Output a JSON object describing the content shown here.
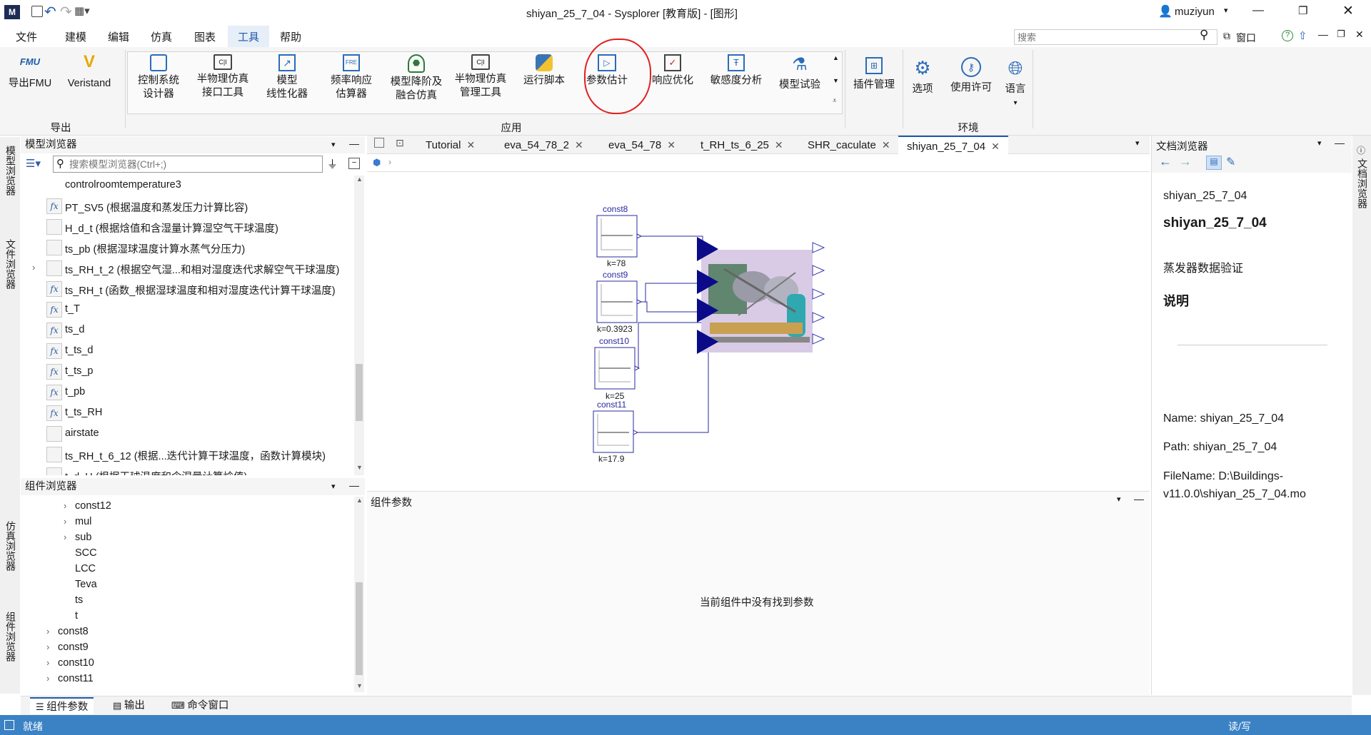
{
  "window": {
    "title": "shiyan_25_7_04 - Sysplorer [教育版] - [图形]",
    "user": "muziyun"
  },
  "menu": [
    "文件",
    "建模",
    "编辑",
    "仿真",
    "图表",
    "工具",
    "帮助"
  ],
  "search": {
    "placeholder": "搜索",
    "window_label": "窗口"
  },
  "ribbon": {
    "export": {
      "group": "导出",
      "items": [
        "导出FMU",
        "Veristand"
      ]
    },
    "app": {
      "group": "应用",
      "items": [
        [
          "控制系统",
          "设计器"
        ],
        [
          "半物理仿真",
          "接口工具"
        ],
        [
          "模型",
          "线性化器"
        ],
        [
          "频率响应",
          "估算器"
        ],
        [
          "模型降阶及",
          "融合仿真"
        ],
        [
          "半物理仿真",
          "管理工具"
        ],
        [
          "运行脚本"
        ],
        [
          "参数估计"
        ],
        [
          "响应优化"
        ],
        [
          "敏感度分析"
        ],
        [
          "模型试验"
        ]
      ]
    },
    "plugin": "插件管理",
    "env": {
      "group": "环境",
      "items": [
        "选项",
        "使用许可",
        "语言"
      ]
    }
  },
  "model_browser": {
    "title": "模型浏览器",
    "search_placeholder": "搜索模型浏览器(Ctrl+;)",
    "items": [
      {
        "label": "controlroomtemperature3",
        "icon": "none"
      },
      {
        "label": "PT_SV5 (根据温度和蒸发压力计算比容)",
        "icon": "fx"
      },
      {
        "label": "H_d_t (根据焓值和含湿量计算湿空气干球温度)",
        "icon": "box"
      },
      {
        "label": "ts_pb (根据湿球温度计算水蒸气分压力)",
        "icon": "box"
      },
      {
        "label": "ts_RH_t_2 (根据空气湿...和相对湿度迭代求解空气干球温度)",
        "icon": "box",
        "expandable": true
      },
      {
        "label": "ts_RH_t (函数_根据湿球温度和相对湿度迭代计算干球温度)",
        "icon": "fx"
      },
      {
        "label": "t_T",
        "icon": "fx"
      },
      {
        "label": "ts_d",
        "icon": "fx"
      },
      {
        "label": "t_ts_d",
        "icon": "fx"
      },
      {
        "label": "t_ts_p",
        "icon": "fx"
      },
      {
        "label": "t_pb",
        "icon": "fx"
      },
      {
        "label": "t_ts_RH",
        "icon": "fx"
      },
      {
        "label": "airstate",
        "icon": "box"
      },
      {
        "label": "ts_RH_t_6_12 (根据...迭代计算干球温度，函数计算模块)",
        "icon": "box"
      },
      {
        "label": "t_d_H (根据干球温度和含湿量计算焓值)",
        "icon": "box"
      }
    ]
  },
  "component_browser": {
    "title": "组件浏览器",
    "items": [
      {
        "label": "const12",
        "indent": 1,
        "exp": true
      },
      {
        "label": "mul",
        "indent": 1,
        "exp": true
      },
      {
        "label": "sub",
        "indent": 1,
        "exp": true
      },
      {
        "label": "SCC",
        "indent": 1,
        "exp": false
      },
      {
        "label": "LCC",
        "indent": 1,
        "exp": false
      },
      {
        "label": "Teva",
        "indent": 1,
        "exp": false
      },
      {
        "label": "ts",
        "indent": 1,
        "exp": false
      },
      {
        "label": "t",
        "indent": 1,
        "exp": false
      },
      {
        "label": "const8",
        "indent": 0,
        "exp": true
      },
      {
        "label": "const9",
        "indent": 0,
        "exp": true
      },
      {
        "label": "const10",
        "indent": 0,
        "exp": true
      },
      {
        "label": "const11",
        "indent": 0,
        "exp": true
      }
    ]
  },
  "left_vtabs": [
    "模型浏览器",
    "文件浏览器",
    "仿真浏览器",
    "组件浏览器"
  ],
  "tabs": [
    "Tutorial",
    "eva_54_78_2",
    "eva_54_78",
    "t_RH_ts_6_25",
    "SHR_caculate",
    "shiyan_25_7_04"
  ],
  "active_tab": "shiyan_25_7_04",
  "diagram": {
    "blocks": [
      {
        "name": "const8",
        "param": "k=78"
      },
      {
        "name": "const9",
        "param": "k=0.3923"
      },
      {
        "name": "const10",
        "param": "k=25"
      },
      {
        "name": "const11",
        "param": "k=17.9"
      }
    ]
  },
  "params_panel": {
    "title": "组件参数",
    "empty_msg": "当前组件中没有找到参数"
  },
  "doc_browser": {
    "title": "文档浏览器",
    "vtab": "文档浏览器",
    "model": "shiyan_25_7_04",
    "heading": "shiyan_25_7_04",
    "desc": "蒸发器数据验证",
    "section": "说明",
    "name_line": "Name: shiyan_25_7_04",
    "path_line": "Path: shiyan_25_7_04",
    "file_line1": "FileName: D:\\Buildings-",
    "file_line2": "v11.0.0\\shiyan_25_7_04.mo"
  },
  "bottom_tabs": [
    "组件参数",
    "输出",
    "命令窗口"
  ],
  "status": {
    "left": "就绪",
    "right": "读/写"
  },
  "colors": {
    "accent": "#1e5aa8",
    "status_bar": "#3b82c4",
    "annotation_circle": "#e02020",
    "triangle": "#0b0b8a"
  }
}
